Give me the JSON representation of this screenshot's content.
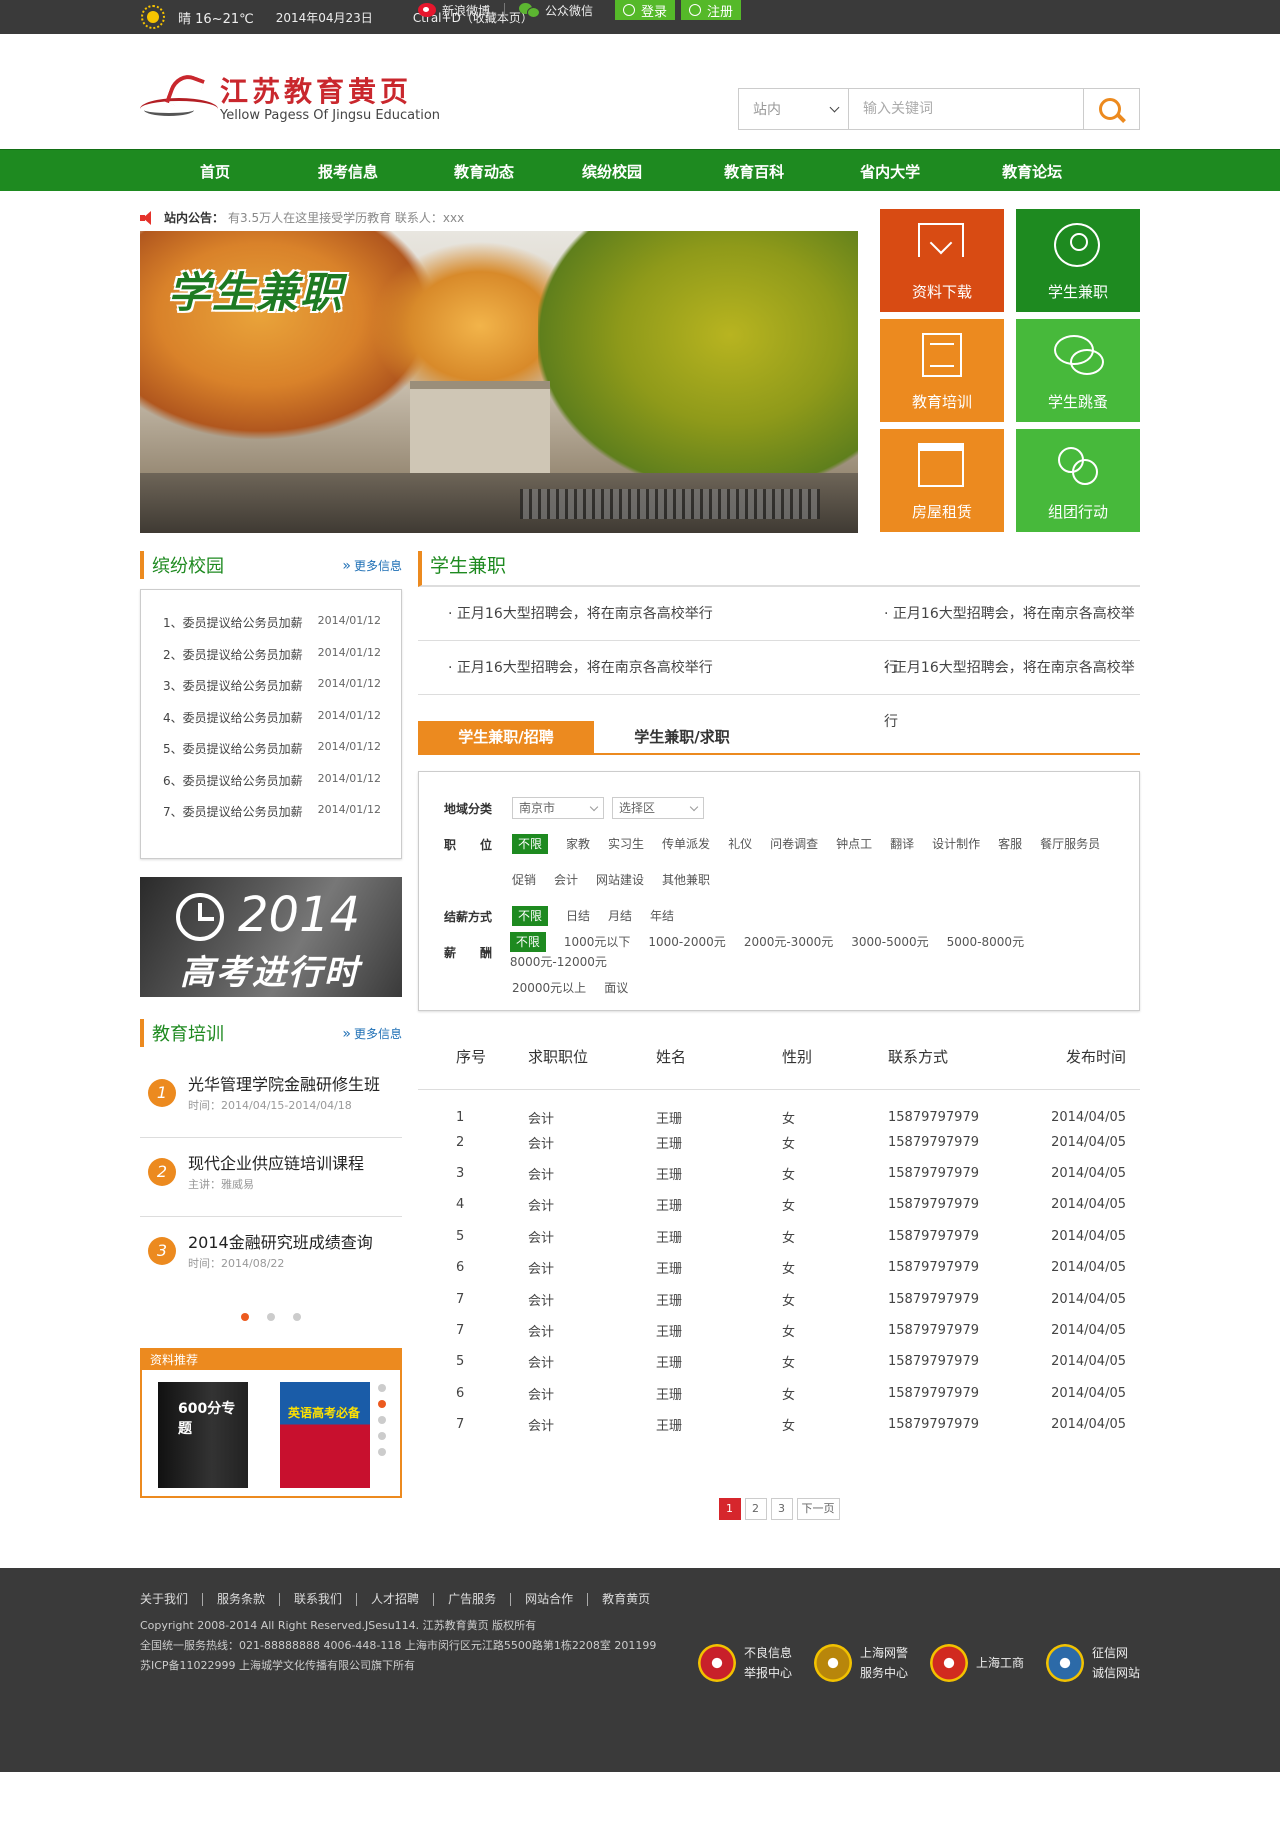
{
  "topbar": {
    "weather": "晴 16~21℃",
    "date": "2014年04月23日",
    "bookmark": "Ctral+D（收藏本页）",
    "weibo": "新浪微博",
    "wechat": "公众微信",
    "login": "登录",
    "register": "注册"
  },
  "header": {
    "logo_cn": "江苏教育黄页",
    "logo_en": "Yellow Pagess Of Jingsu Education",
    "search_scope": "站内",
    "search_placeholder": "输入关键词"
  },
  "nav": [
    "首页",
    "报考信息",
    "教育动态",
    "缤纷校园",
    "教育百科",
    "省内大学",
    "教育论坛"
  ],
  "notice": {
    "label": "站内公告：",
    "text": "有3.5万人在这里接受学历教育   联系人：xxx"
  },
  "banner": {
    "title": "学生兼职"
  },
  "tiles": [
    "资料下载",
    "学生兼职",
    "教育培训",
    "学生跳蚤",
    "房屋租赁",
    "组团行动"
  ],
  "tile_colors": [
    "#d84b13",
    "#1e8a20",
    "#ec8a1f",
    "#47b93b",
    "#ec8a1f",
    "#47b93b"
  ],
  "campus": {
    "title": "缤纷校园",
    "more": "更多信息",
    "items": [
      {
        "n": "1、",
        "t": "委员提议给公务员加薪",
        "d": "2014/01/12"
      },
      {
        "n": "2、",
        "t": "委员提议给公务员加薪",
        "d": "2014/01/12"
      },
      {
        "n": "3、",
        "t": "委员提议给公务员加薪",
        "d": "2014/01/12"
      },
      {
        "n": "4、",
        "t": "委员提议给公务员加薪",
        "d": "2014/01/12"
      },
      {
        "n": "5、",
        "t": "委员提议给公务员加薪",
        "d": "2014/01/12"
      },
      {
        "n": "6、",
        "t": "委员提议给公务员加薪",
        "d": "2014/01/12"
      },
      {
        "n": "7、",
        "t": "委员提议给公务员加薪",
        "d": "2014/01/12"
      }
    ]
  },
  "ad": {
    "year": "2014",
    "caption": "高考进行时"
  },
  "training": {
    "title": "教育培训",
    "more": "更多信息",
    "items": [
      {
        "n": "1",
        "t": "光华管理学院金融研修生班",
        "s": "时间：2014/04/15-2014/04/18"
      },
      {
        "n": "2",
        "t": "现代企业供应链培训课程",
        "s": "主讲：雅威易"
      },
      {
        "n": "3",
        "t": "2014金融研究班成绩查询",
        "s": "时间：2014/08/22"
      }
    ]
  },
  "recommend": {
    "title": "资料推荐",
    "book1": "600分专题",
    "book2": "英语高考必备"
  },
  "parttime": {
    "title": "学生兼职",
    "news": [
      "正月16大型招聘会，将在南京各高校举行",
      "正月16大型招聘会，将在南京各高校举行",
      "正月16大型招聘会，将在南京各高校举行",
      "正月16大型招聘会，将在南京各高校举行"
    ],
    "tabs": [
      "学生兼职/招聘",
      "学生兼职/求职"
    ]
  },
  "filter": {
    "region_label": "地域分类",
    "city": "南京市",
    "district": "选择区",
    "position_label": "职　　位",
    "positions": [
      "不限",
      "家教",
      "实习生",
      "传单派发",
      "礼仪",
      "问卷调查",
      "钟点工",
      "翻译",
      "设计制作",
      "客服",
      "餐厅服务员"
    ],
    "positions2": [
      "促销",
      "会计",
      "网站建设",
      "其他兼职"
    ],
    "pay_label": "结薪方式",
    "pay": [
      "不限",
      "日结",
      "月结",
      "年结"
    ],
    "salary_label": "薪　　酬",
    "salary": [
      "不限",
      "1000元以下",
      "1000-2000元",
      "2000元-3000元",
      "3000-5000元",
      "5000-8000元",
      "8000元-12000元"
    ],
    "salary2": [
      "20000元以上",
      "面议"
    ]
  },
  "table": {
    "headers": [
      "序号",
      "求职职位",
      "姓名",
      "性别",
      "联系方式",
      "发布时间"
    ],
    "rows": [
      [
        "1",
        "会计",
        "王珊",
        "女",
        "15879797979",
        "2014/04/05"
      ],
      [
        "2",
        "会计",
        "王珊",
        "女",
        "15879797979",
        "2014/04/05"
      ],
      [
        "3",
        "会计",
        "王珊",
        "女",
        "15879797979",
        "2014/04/05"
      ],
      [
        "4",
        "会计",
        "王珊",
        "女",
        "15879797979",
        "2014/04/05"
      ],
      [
        "5",
        "会计",
        "王珊",
        "女",
        "15879797979",
        "2014/04/05"
      ],
      [
        "6",
        "会计",
        "王珊",
        "女",
        "15879797979",
        "2014/04/05"
      ],
      [
        "7",
        "会计",
        "王珊",
        "女",
        "15879797979",
        "2014/04/05"
      ],
      [
        "7",
        "会计",
        "王珊",
        "女",
        "15879797979",
        "2014/04/05"
      ],
      [
        "5",
        "会计",
        "王珊",
        "女",
        "15879797979",
        "2014/04/05"
      ],
      [
        "6",
        "会计",
        "王珊",
        "女",
        "15879797979",
        "2014/04/05"
      ],
      [
        "7",
        "会计",
        "王珊",
        "女",
        "15879797979",
        "2014/04/05"
      ]
    ]
  },
  "pagination": [
    "1",
    "2",
    "3",
    "下一页"
  ],
  "footer": {
    "links": [
      "关于我们",
      "服务条款",
      "联系我们",
      "人才招聘",
      "广告服务",
      "网站合作",
      "教育黄页"
    ],
    "copyright": "Copyright 2008-2014 All Right Reserved.JSesu114. 江苏教育黄页 版权所有",
    "hotline": "全国统一服务热线：021-88888888 4006-448-118   上海市闵行区元江路5500路第1栋2208室 201199",
    "icp": "苏ICP备11022999   上海城学文化传播有限公司旗下所有",
    "badges": [
      {
        "l1": "不良信息",
        "l2": "举报中心",
        "c": "#c8202a"
      },
      {
        "l1": "上海网警",
        "l2": "服务中心",
        "c": "#b8860b"
      },
      {
        "l1": "上海工商",
        "l2": "",
        "c": "#d12a1f"
      },
      {
        "l1": "征信网",
        "l2": "诚信网站",
        "c": "#2c6aa8"
      }
    ]
  }
}
